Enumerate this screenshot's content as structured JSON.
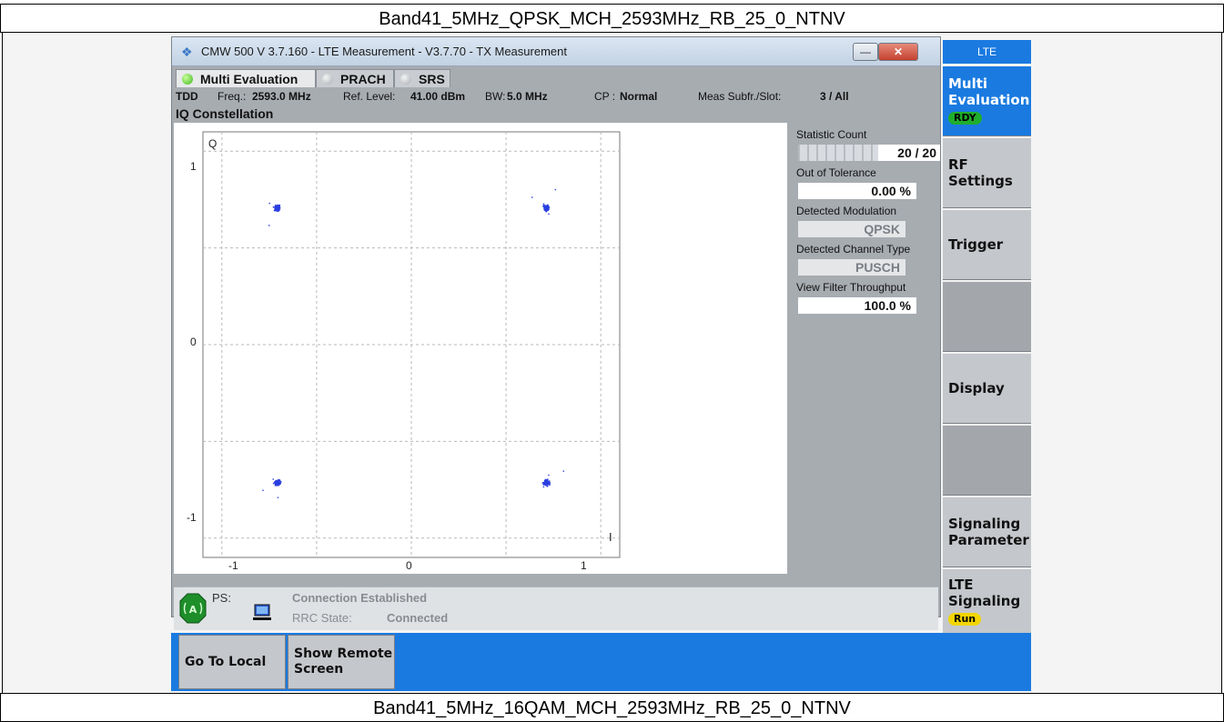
{
  "captions": {
    "top": "Band41_5MHz_QPSK_MCH_2593MHz_RB_25_0_NTNV",
    "bottom": "Band41_5MHz_16QAM_MCH_2593MHz_RB_25_0_NTNV"
  },
  "window": {
    "title": "CMW 500 V 3.7.160 - LTE Measurement  - V3.7.70 - TX Measurement",
    "minimize_glyph": "—",
    "close_glyph": "✕"
  },
  "tabs": [
    {
      "label": "Multi Evaluation",
      "active": true
    },
    {
      "label": "PRACH",
      "active": false
    },
    {
      "label": "SRS",
      "active": false
    }
  ],
  "info": {
    "duplex": "TDD",
    "freq_label": "Freq.:",
    "freq_value": "2593.0 MHz",
    "ref_label": "Ref. Level:",
    "ref_value": "41.00 dBm",
    "bw_label": "BW:",
    "bw_value": "5.0 MHz",
    "cp_label": "CP :",
    "cp_value": "Normal",
    "meas_label": "Meas Subfr./Slot:",
    "meas_value": "3  / All"
  },
  "plot": {
    "title": "IQ Constellation",
    "q_axis_label": "Q",
    "i_axis_label": "I",
    "x_ticks": [
      "-1",
      "0",
      "1"
    ],
    "y_ticks": [
      "1",
      "0",
      "-1"
    ],
    "point_color": "#2b3fe0",
    "clusters": [
      {
        "i": -0.71,
        "q": 0.71
      },
      {
        "i": 0.71,
        "q": 0.71
      },
      {
        "i": -0.71,
        "q": -0.71
      },
      {
        "i": 0.71,
        "q": -0.71
      }
    ]
  },
  "stats": {
    "statistic_count_label": "Statistic Count",
    "statistic_count_value": "20 / 20",
    "statistic_count_progress": 1.0,
    "out_of_tolerance_label": "Out of Tolerance",
    "out_of_tolerance_value": "0.00  %",
    "detected_modulation_label": "Detected Modulation",
    "detected_modulation_value": "QPSK",
    "detected_channel_label": "Detected Channel Type",
    "detected_channel_value": "PUSCH",
    "view_filter_label": "View Filter Throughput",
    "view_filter_value": "100.0  %"
  },
  "status": {
    "ps_label": "PS:",
    "connection": "Connection Established",
    "rrc_label": "RRC State:",
    "rrc_value": "Connected"
  },
  "softkeys": {
    "header": "LTE",
    "multi_line1": "Multi",
    "multi_line2": "Evaluation",
    "multi_badge": "RDY",
    "rf_line1": "RF",
    "rf_line2": "Settings",
    "trigger": "Trigger",
    "display": "Display",
    "signaling_line1": "Signaling",
    "signaling_line2": "Parameter",
    "lte_line1": "LTE",
    "lte_line2": "Signaling",
    "lte_badge": "Run"
  },
  "bottom_keys": {
    "go_local": "Go To Local",
    "remote_line1": "Show Remote",
    "remote_line2": "Screen"
  },
  "colors": {
    "accent_blue": "#1a7ae0",
    "rdy_green": "#1fae2c",
    "run_yellow": "#f2d500"
  }
}
